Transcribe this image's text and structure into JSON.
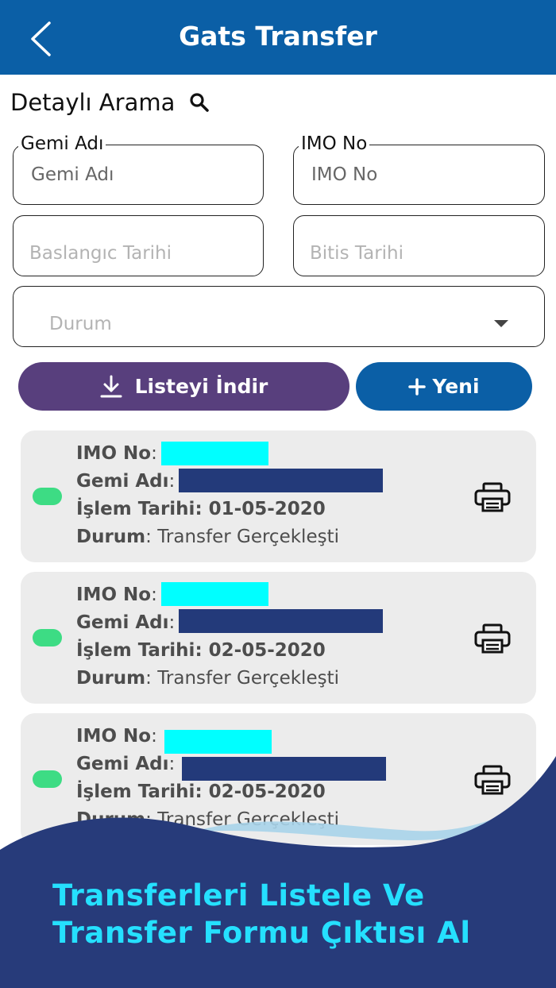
{
  "header": {
    "title": "Gats Transfer"
  },
  "search": {
    "title": "Detaylı Arama"
  },
  "filters": {
    "gemi_label": "Gemi Adı",
    "gemi_placeholder": "Gemi Adı",
    "imo_label": "IMO No",
    "imo_placeholder": "IMO No",
    "start_placeholder": "Baslangıc Tarihi",
    "end_placeholder": "Bitis Tarihi",
    "status_placeholder": "Durum"
  },
  "actions": {
    "download_label": "Listeyi İndir",
    "new_label": "Yeni"
  },
  "records": [
    {
      "imo_label": "IMO No",
      "ship_label": "Gemi Adı",
      "date_label": "İşlem Tarihi",
      "date": "01-05-2020",
      "status_label": "Durum",
      "status": "Transfer Gerçekleşti"
    },
    {
      "imo_label": "IMO No",
      "ship_label": "Gemi Adı",
      "date_label": "İşlem Tarihi",
      "date": "02-05-2020",
      "status_label": "Durum",
      "status": "Transfer Gerçekleşti"
    },
    {
      "imo_label": "IMO No",
      "ship_label": "Gemi Adı",
      "date_label": "İşlem Tarihi",
      "date": "02-05-2020",
      "status_label": "Durum",
      "status": "Transfer Gerçekleşti"
    }
  ],
  "banner": {
    "line1": "Transferleri Listele Ve",
    "line2": "Transfer Formu Çıktısı Al"
  },
  "colors": {
    "primary": "#0b5fa6",
    "download": "#583f7d",
    "status_ok": "#3ddc84",
    "banner_bg": "#273b7a",
    "banner_text": "#25e0ff"
  },
  "icons": [
    "back-chevron-icon",
    "search-icon",
    "dropdown-caret-icon",
    "download-icon",
    "plus-icon",
    "printer-icon"
  ]
}
